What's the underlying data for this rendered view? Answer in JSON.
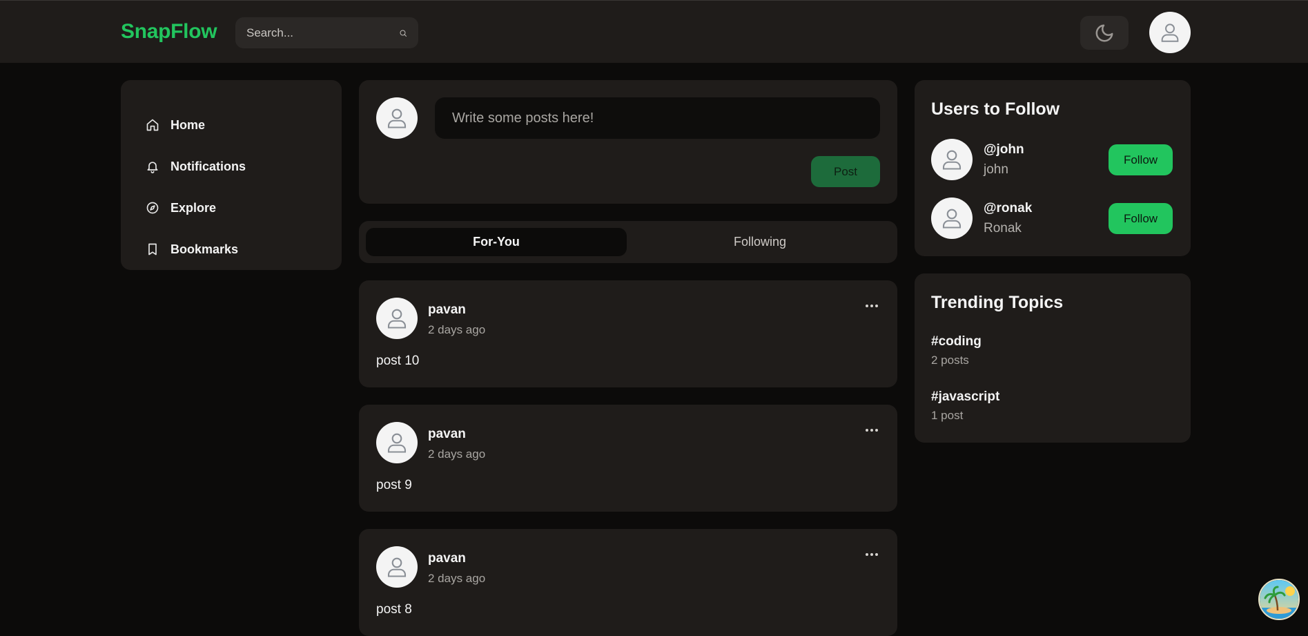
{
  "brand": {
    "name": "SnapFlow",
    "accent": "#22c55e"
  },
  "search": {
    "placeholder": "Search...",
    "icon": "search-icon"
  },
  "header": {
    "theme_icon": "moon-icon",
    "avatar_icon": "user-icon"
  },
  "sidebar": {
    "items": [
      {
        "label": "Home",
        "icon": "home-icon"
      },
      {
        "label": "Notifications",
        "icon": "bell-icon"
      },
      {
        "label": "Explore",
        "icon": "compass-icon"
      },
      {
        "label": "Bookmarks",
        "icon": "bookmark-icon"
      }
    ]
  },
  "composer": {
    "placeholder": "Write some posts here!",
    "post_label": "Post"
  },
  "feed": {
    "tabs": [
      {
        "label": "For-You",
        "active": true
      },
      {
        "label": "Following",
        "active": false
      }
    ],
    "posts": [
      {
        "author": "pavan",
        "time": "2 days ago",
        "content": "post 10"
      },
      {
        "author": "pavan",
        "time": "2 days ago",
        "content": "post 9"
      },
      {
        "author": "pavan",
        "time": "2 days ago",
        "content": "post 8"
      }
    ]
  },
  "users_to_follow": {
    "title": "Users to Follow",
    "users": [
      {
        "handle": "@john",
        "name": "john",
        "button": "Follow"
      },
      {
        "handle": "@ronak",
        "name": "Ronak",
        "button": "Follow"
      }
    ]
  },
  "trending": {
    "title": "Trending Topics",
    "topics": [
      {
        "tag": "#coding",
        "count": "2 posts"
      },
      {
        "tag": "#javascript",
        "count": "1 post"
      }
    ]
  },
  "colors": {
    "page_bg": "#0c0b0a",
    "card_bg": "#1f1c1a",
    "follow_button": "#22c55e",
    "post_button": "#1d6b3b"
  }
}
